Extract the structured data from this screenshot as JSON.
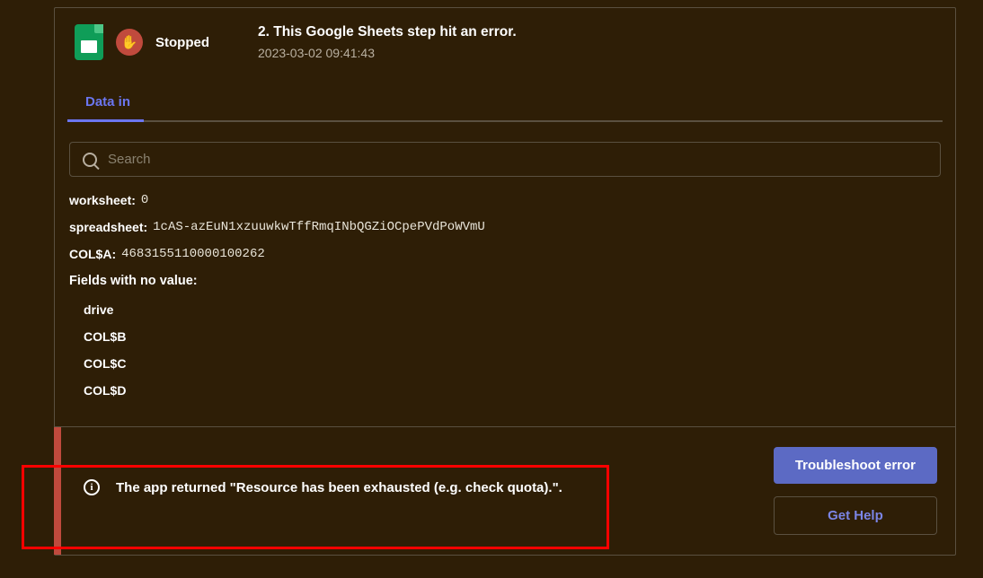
{
  "header": {
    "status": "Stopped",
    "title": "2. This Google Sheets step hit an error.",
    "timestamp": "2023-03-02 09:41:43"
  },
  "tabs": {
    "data_in": "Data in"
  },
  "search": {
    "placeholder": "Search"
  },
  "data": {
    "worksheet_label": "worksheet:",
    "worksheet_value": "0",
    "spreadsheet_label": "spreadsheet:",
    "spreadsheet_value": "1cAS-azEuN1xzuuwkwTffRmqINbQGZiOCpePVdPoWVmU",
    "col_a_label": "COL$A:",
    "col_a_value": "4683155110000100262"
  },
  "no_value": {
    "title": "Fields with no value:",
    "items": [
      "drive",
      "COL$B",
      "COL$C",
      "COL$D"
    ]
  },
  "error": {
    "message": "The app returned \"Resource has been exhausted (e.g. check quota).\".",
    "troubleshoot_button": "Troubleshoot error",
    "get_help_button": "Get Help"
  }
}
